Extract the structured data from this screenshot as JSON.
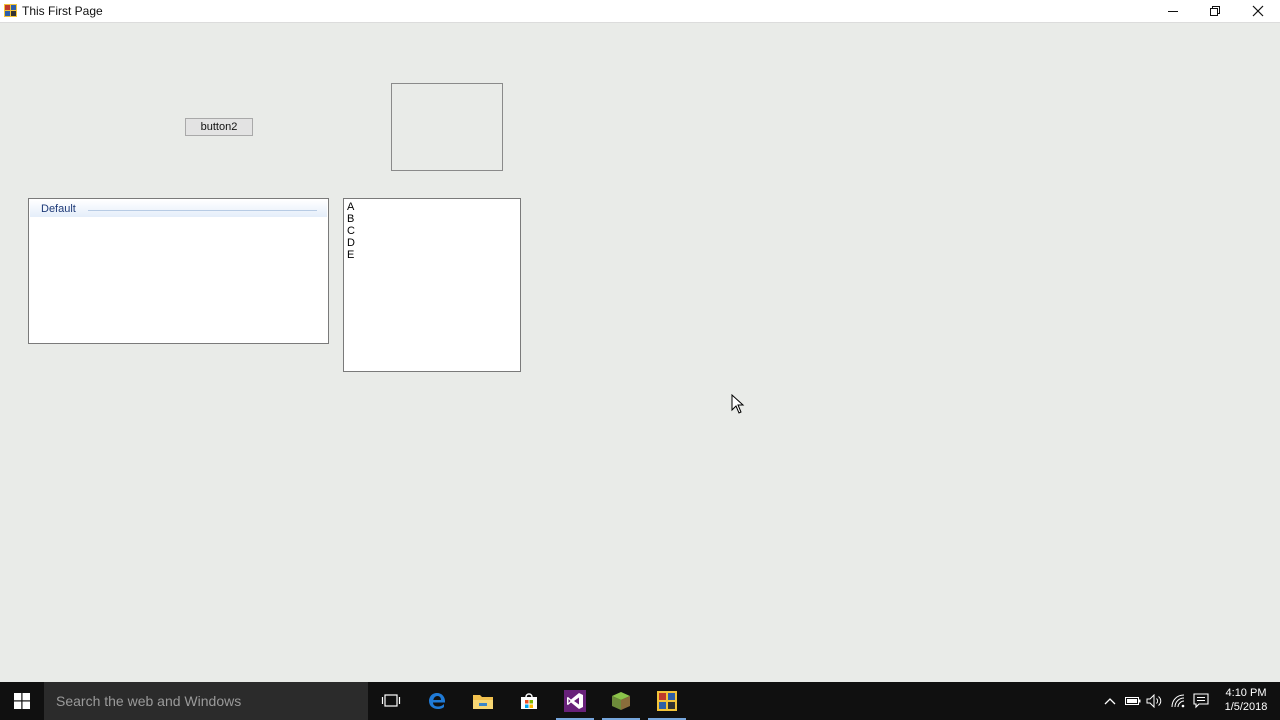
{
  "window": {
    "title": "This First Page",
    "icon": "winforms-app-icon",
    "controls": [
      "minimize-icon",
      "restore-icon",
      "close-icon"
    ]
  },
  "form": {
    "button2_label": "button2",
    "listview": {
      "group_header": "Default"
    },
    "listbox": {
      "items": [
        "A",
        "B",
        "C",
        "D",
        "E"
      ]
    }
  },
  "taskbar": {
    "search_placeholder": "Search the web and Windows",
    "pinned": [
      "task-view-icon",
      "edge-icon",
      "file-explorer-icon",
      "store-icon",
      "visual-studio-icon",
      "minecraft-icon",
      "winforms-app-icon"
    ],
    "tray_icons": [
      "chevron-up-icon",
      "battery-icon",
      "volume-icon",
      "wifi-icon",
      "action-center-icon"
    ],
    "clock": {
      "time": "4:10 PM",
      "date": "1/5/2018"
    }
  }
}
